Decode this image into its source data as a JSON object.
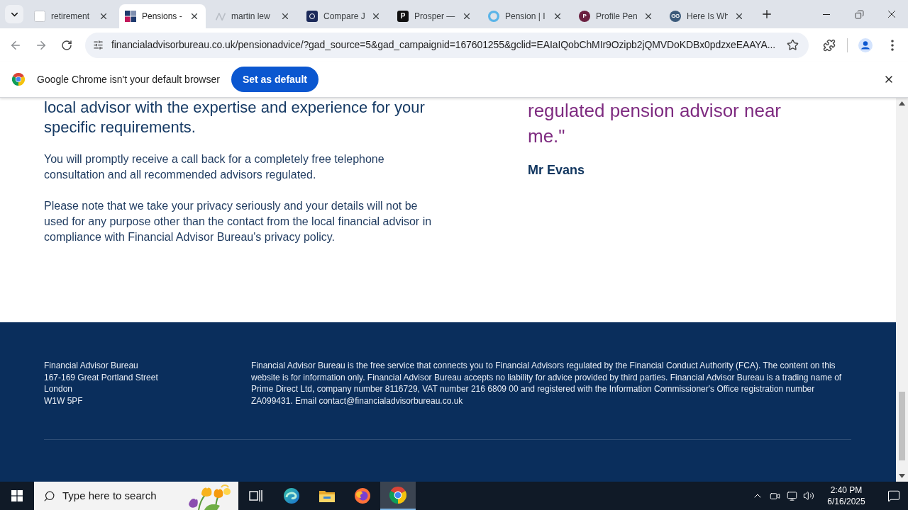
{
  "browser": {
    "tabs": [
      {
        "title": "retirement",
        "selected": false,
        "kind": "page"
      },
      {
        "title": "Pensions -",
        "selected": true,
        "kind": "tiles"
      },
      {
        "title": "martin lew",
        "selected": false,
        "kind": "faint"
      },
      {
        "title": "Compare J",
        "selected": false,
        "kind": "tile",
        "color": "#1c2a5a"
      },
      {
        "title": "Prosper —",
        "selected": false,
        "kind": "tile",
        "color": "#111111",
        "letter": "P"
      },
      {
        "title": "Pension | I",
        "selected": false,
        "kind": "ring",
        "color": "#5ab4e8"
      },
      {
        "title": "Profile Pen",
        "selected": false,
        "kind": "disc",
        "color": "#6b2040",
        "letter": "P"
      },
      {
        "title": "Here Is Wh",
        "selected": false,
        "kind": "disc",
        "color": "#3b5a7a",
        "letter": "GG"
      }
    ],
    "address_bar": {
      "url": "financialadvisorbureau.co.uk/pensionadvice/?gad_source=5&gad_campaignid=167601255&gclid=EAIaIQobChMIr9Ozipb2jQMVDoKDBx0pdzxeEAAYA..."
    },
    "infobar": {
      "message": "Google Chrome isn't your default browser",
      "button": "Set as default"
    }
  },
  "page": {
    "intro": {
      "heading": "local advisor with the expertise and experience for your specific requirements.",
      "paragraphs": [
        "You will promptly receive a call back for a completely free telephone consultation and all recommended advisors regulated.",
        "Please note that we take your privacy seriously and your details will not be used for any purpose other than the contact from the local financial advisor in compliance with Financial Advisor Bureau's privacy policy."
      ]
    },
    "testimonial": {
      "quote": "regulated pension advisor near me.\"",
      "author": "Mr Evans"
    },
    "footer": {
      "address_lines": [
        "Financial Advisor Bureau",
        "167-169 Great Portland Street",
        "London",
        "W1W 5PF"
      ],
      "disclaimer": "Financial Advisor Bureau is the free service that connects you to Financial Advisors regulated by the Financial Conduct Authority (FCA). The content on this website is for information only. Financial Advisor Bureau accepts no liability for advice provided by third parties. Financial Advisor Bureau is a trading name of Prime Direct Ltd, company number 8116729, VAT number 216 6809 00 and registered with the Information Commissioner's Office registration number ZA099431. Email contact@financialadvisorbureau.co.uk"
    }
  },
  "taskbar": {
    "search": {
      "placeholder": "Type here to search"
    },
    "apps": [
      {
        "kind": "taskview",
        "active": false
      },
      {
        "kind": "swirl",
        "active": false
      },
      {
        "kind": "folder",
        "active": false
      },
      {
        "kind": "flame",
        "active": false
      },
      {
        "kind": "segments",
        "active": true
      }
    ],
    "clock": {
      "time": "2:40 PM",
      "date": "6/16/2025"
    }
  }
}
